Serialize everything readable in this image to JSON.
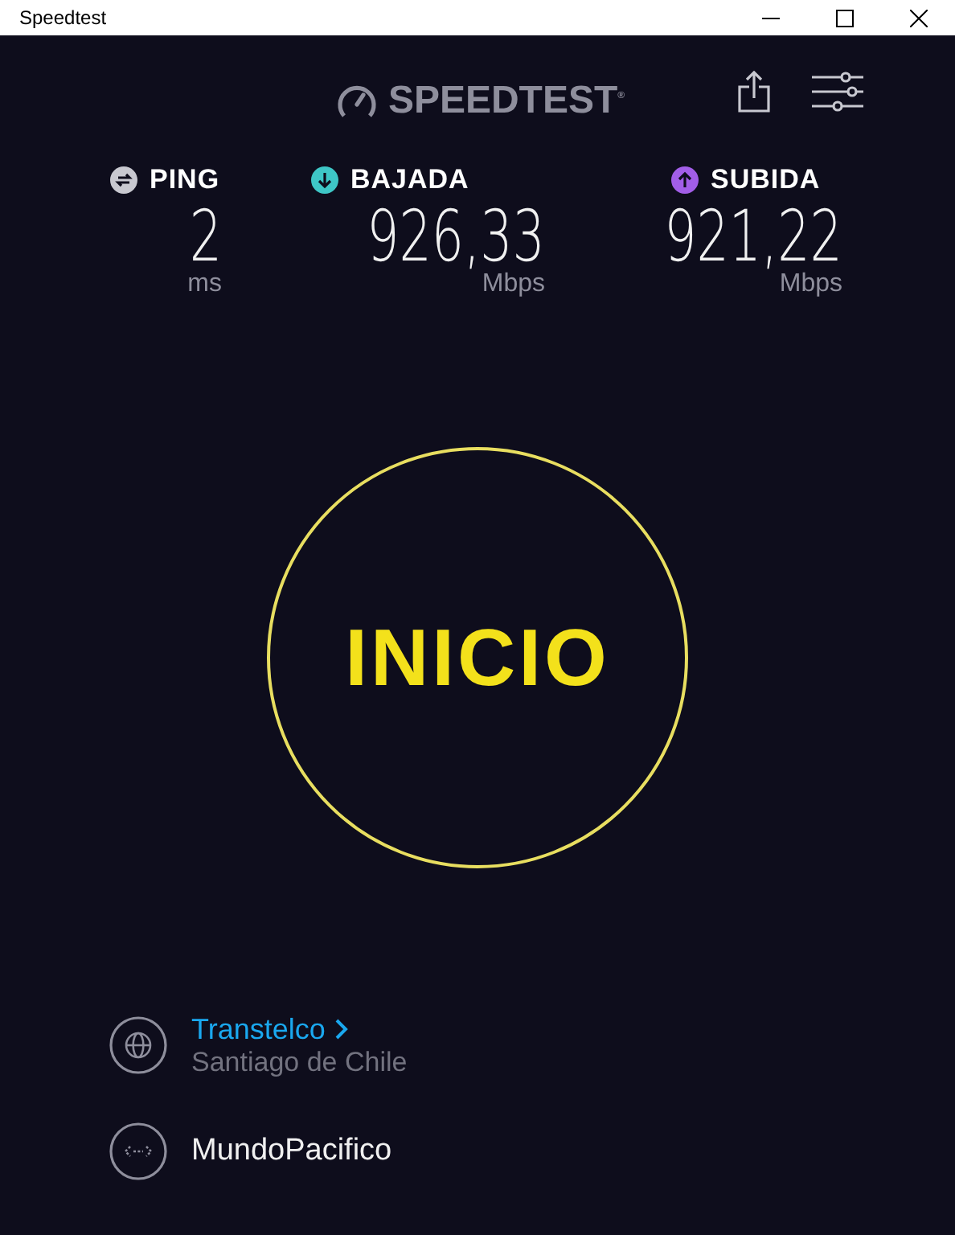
{
  "window": {
    "title": "Speedtest"
  },
  "logo": {
    "text": "SPEEDTEST$^{®}$"
  },
  "metrics": [
    {
      "kind": "ping",
      "label": "PING",
      "value": "2",
      "unit": "ms",
      "color": "#c8c8d0"
    },
    {
      "kind": "download",
      "label": "BAJADA",
      "value": "926,33",
      "unit": "Mbps",
      "color": "#3ec6c6"
    },
    {
      "kind": "upload",
      "label": "SUBIDA",
      "value": "921,22",
      "unit": "Mbps",
      "color": "#a25ee8"
    }
  ],
  "start_button": {
    "label": "INICIO"
  },
  "server": {
    "name": "Transtelco",
    "location": "Santiago de Chile"
  },
  "provider": {
    "name": "MundoPacifico"
  }
}
